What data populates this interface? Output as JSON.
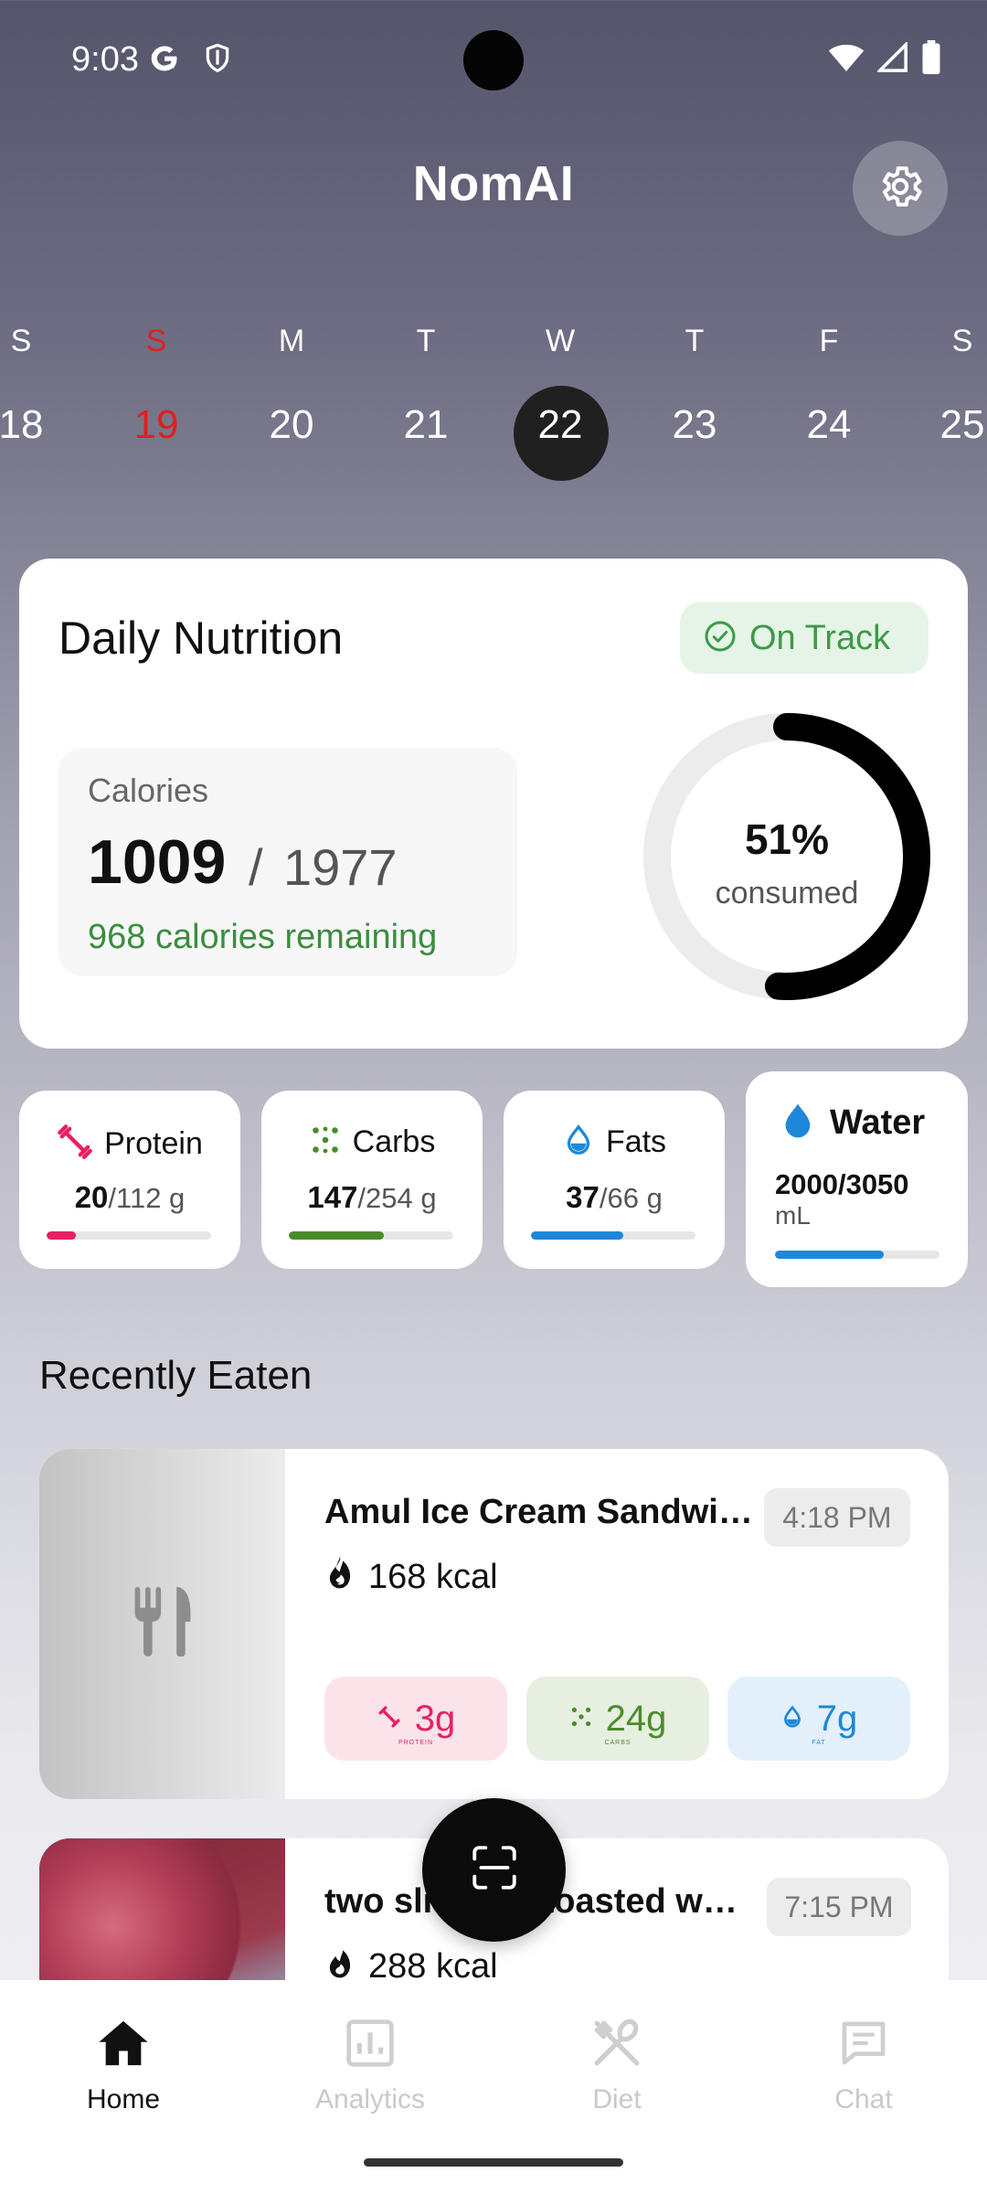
{
  "status_bar": {
    "time": "9:03"
  },
  "header": {
    "title": "NomAI"
  },
  "week": [
    {
      "name": "S",
      "num": "18"
    },
    {
      "name": "S",
      "num": "19"
    },
    {
      "name": "M",
      "num": "20"
    },
    {
      "name": "T",
      "num": "21"
    },
    {
      "name": "W",
      "num": "22"
    },
    {
      "name": "T",
      "num": "23"
    },
    {
      "name": "F",
      "num": "24"
    },
    {
      "name": "S",
      "num": "25"
    }
  ],
  "nutrition": {
    "title": "Daily Nutrition",
    "status": "On Track",
    "calories_label": "Calories",
    "consumed": "1009",
    "separator": "/",
    "target": "1977",
    "remaining": "968 calories remaining",
    "percent": "51%",
    "percent_label": "consumed",
    "progress": 0.51
  },
  "macros": {
    "protein": {
      "label": "Protein",
      "value": "20",
      "target": "/112 g",
      "progress": 0.18,
      "color": "#e91e63"
    },
    "carbs": {
      "label": "Carbs",
      "value": "147",
      "target": "/254 g",
      "progress": 0.58,
      "color": "#4a8c2a"
    },
    "fats": {
      "label": "Fats",
      "value": "37",
      "target": "/66 g",
      "progress": 0.56,
      "color": "#1e88d8"
    }
  },
  "water": {
    "label": "Water",
    "value": "2000/3050",
    "unit": "mL",
    "progress": 0.66,
    "color": "#1e88d8"
  },
  "recent": {
    "title": "Recently Eaten",
    "meals": [
      {
        "name": "Amul Ice Cream Sandwich",
        "time": "4:18 PM",
        "kcal": "168 kcal",
        "protein": "3g",
        "protein_label": "PROTEIN",
        "carbs": "24g",
        "carbs_label": "CARBS",
        "fat": "7g",
        "fat_label": "FAT"
      },
      {
        "name": "two slices of toasted white bread",
        "time": "7:15 PM",
        "kcal": "288 kcal"
      }
    ]
  },
  "nav": {
    "home": "Home",
    "analytics": "Analytics",
    "diet": "Diet",
    "chat": "Chat"
  }
}
